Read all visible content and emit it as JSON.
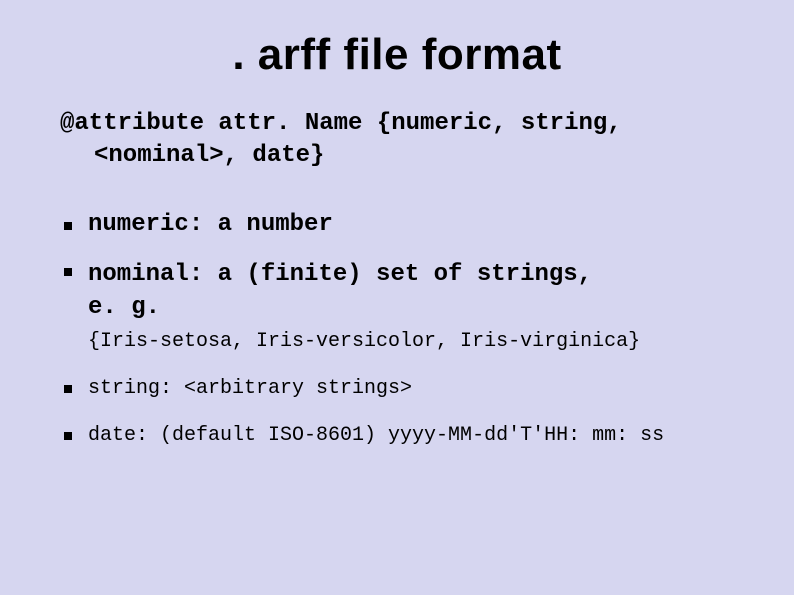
{
  "title": ". arff file format",
  "attr_line1": "@attribute attr. Name {numeric, string,",
  "attr_line2": "<nominal>, date}",
  "items": {
    "numeric": "numeric: a number",
    "nominal_main1": "nominal: a (finite) set of strings,",
    "nominal_main2": "e. g.",
    "nominal_sub": "{Iris-setosa, Iris-versicolor, Iris-virginica}",
    "string": "string: <arbitrary strings>",
    "date": "date: (default ISO-8601) yyyy-MM-dd'T'HH: mm: ss"
  }
}
